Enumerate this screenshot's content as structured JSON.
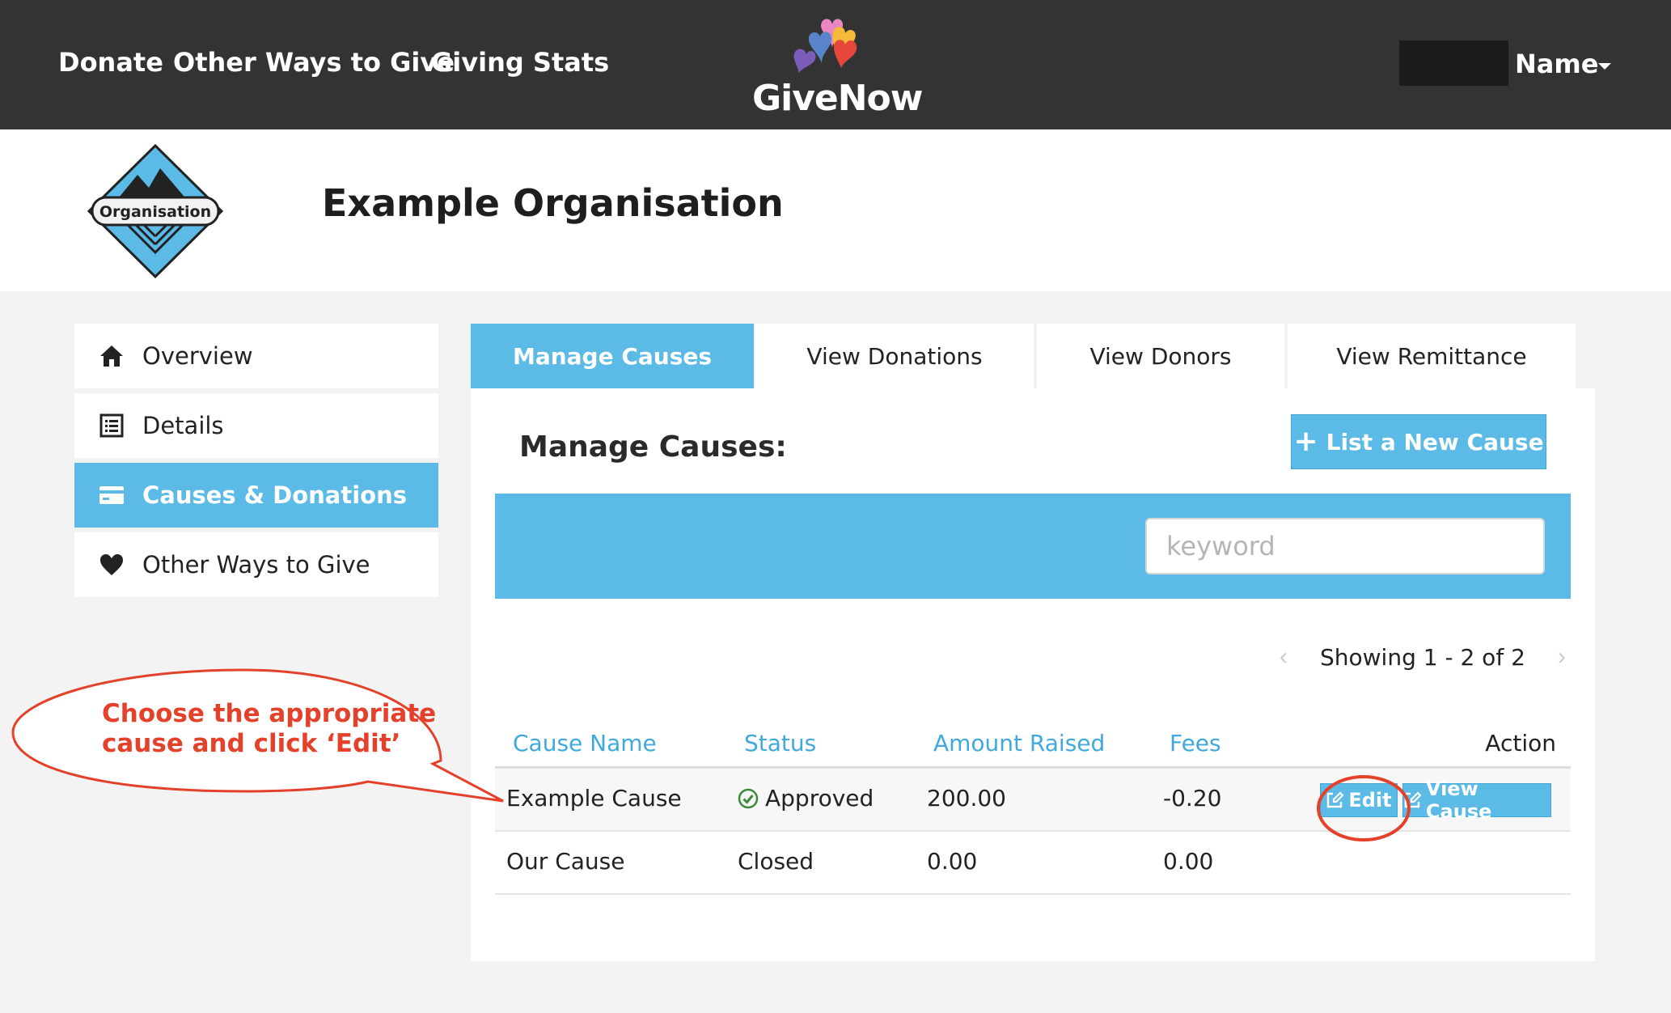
{
  "topnav": {
    "links": [
      "Donate",
      "Other Ways to Give",
      "Giving Stats"
    ],
    "brand": "GiveNow",
    "user_name": "Name"
  },
  "org": {
    "badge_label": "Organisation",
    "title": "Example Organisation"
  },
  "sidebar": {
    "items": [
      {
        "label": "Overview",
        "icon": "home-icon"
      },
      {
        "label": "Details",
        "icon": "list-icon"
      },
      {
        "label": "Causes & Donations",
        "icon": "credit-card-icon",
        "active": true
      },
      {
        "label": "Other Ways to Give",
        "icon": "heart-icon"
      }
    ]
  },
  "tabs": [
    {
      "label": "Manage Causes",
      "active": true
    },
    {
      "label": "View Donations"
    },
    {
      "label": "View Donors"
    },
    {
      "label": "View Remittance"
    }
  ],
  "main": {
    "title": "Manage Causes:",
    "new_cause_label": "List a New Cause",
    "search_placeholder": "keyword",
    "pager_text": "Showing 1 - 2 of 2"
  },
  "table": {
    "headers": [
      "Cause Name",
      "Status",
      "Amount Raised",
      "Fees",
      "Action"
    ],
    "rows": [
      {
        "name": "Example Cause",
        "status": "Approved",
        "amount": "200.00",
        "fees": "-0.20",
        "edit_label": "Edit",
        "view_label": "View Cause"
      },
      {
        "name": "Our Cause",
        "status": "Closed",
        "amount": "0.00",
        "fees": "0.00"
      }
    ]
  },
  "annotation": {
    "text": "Choose the appropriate cause and click ‘Edit’",
    "color": "#e4412b"
  },
  "colors": {
    "topbar": "#333333",
    "accent": "#5bbae6",
    "link": "#3fa9dd"
  }
}
